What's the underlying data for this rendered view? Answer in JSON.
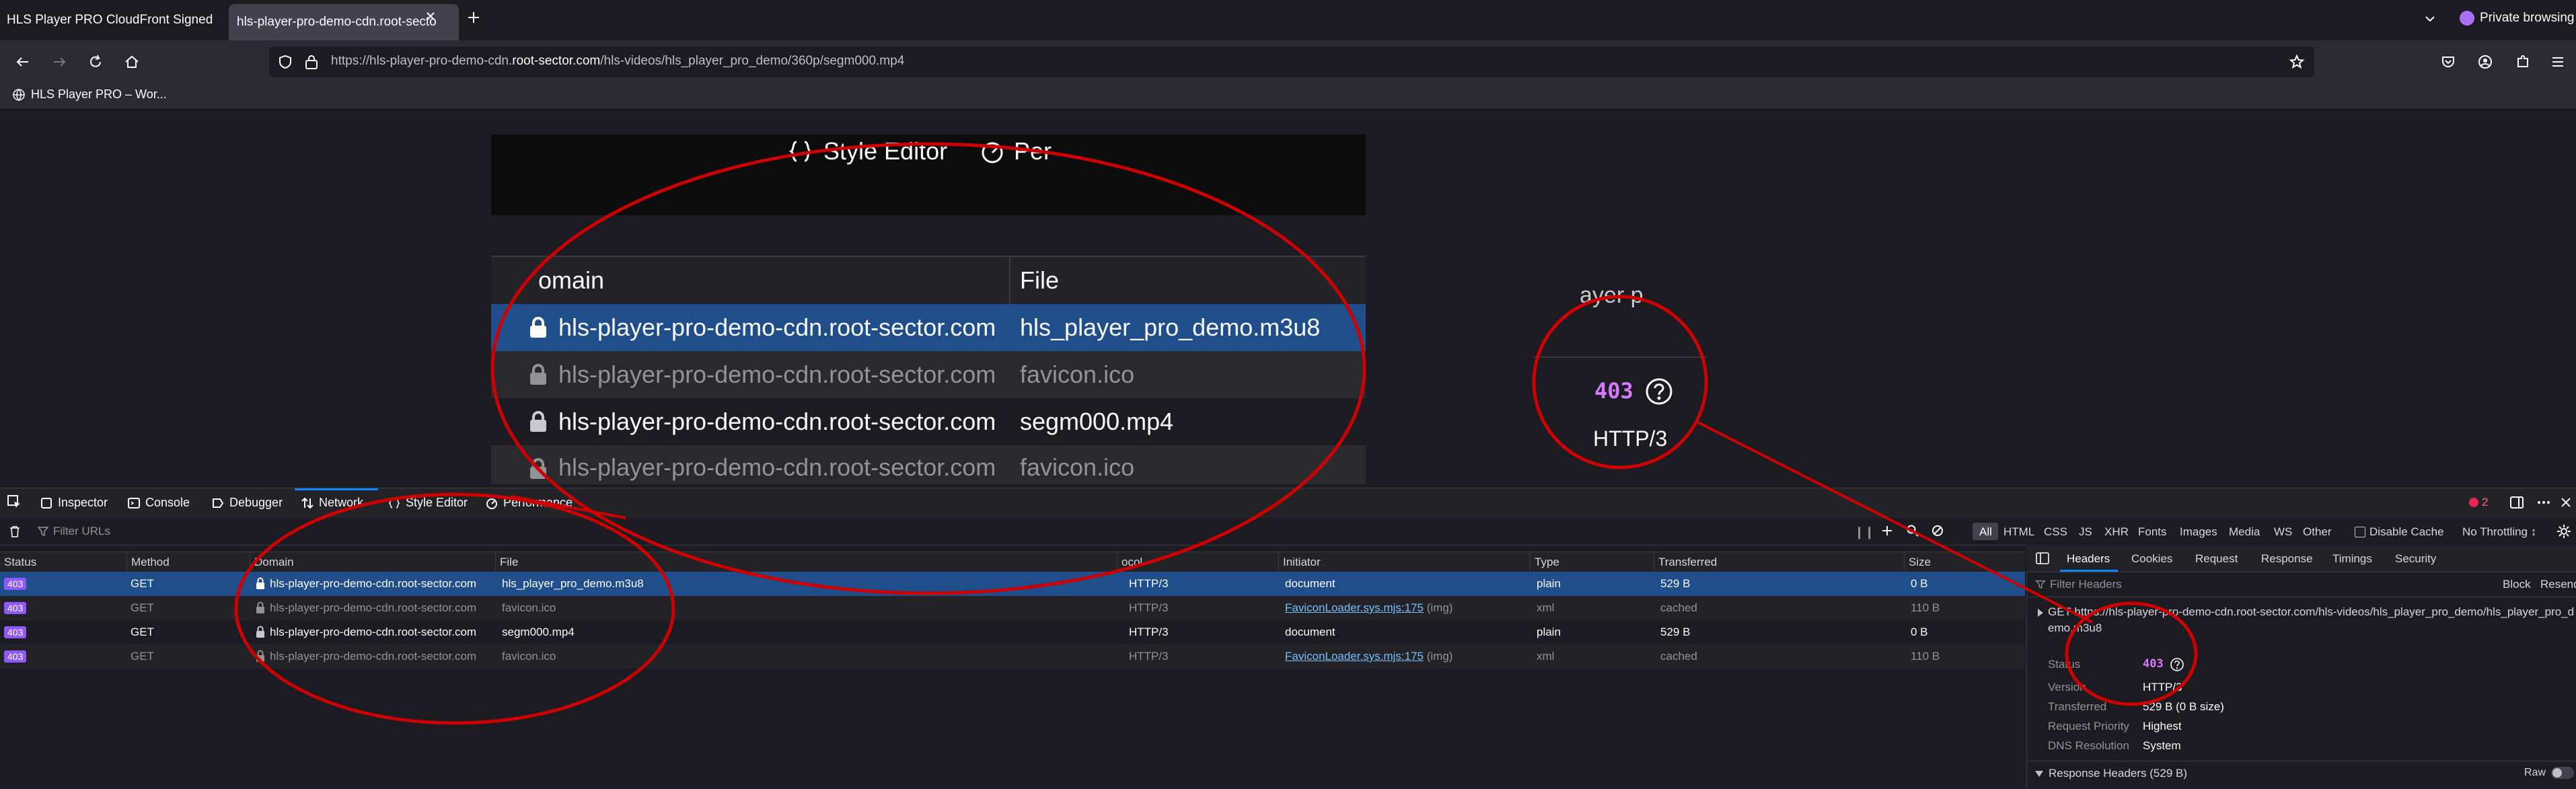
{
  "tabs": [
    {
      "label": "HLS Player PRO CloudFront Signed"
    },
    {
      "label": "hls-player-pro-demo-cdn.root-secto"
    }
  ],
  "private": {
    "label": "Private browsing"
  },
  "url": {
    "host_prefix": "https://hls-player-pro-demo-cdn.",
    "host_domain": "root-sector.com",
    "path": "/hls-videos/hls_player_pro_demo/360p/segm000.mp4"
  },
  "bookmark": {
    "label": "HLS Player PRO – Wor..."
  },
  "zoom_table": {
    "tabs": [
      "Style Editor",
      "Per"
    ],
    "headers": {
      "domain": "omain",
      "file": "File"
    },
    "rows": [
      {
        "domain": "hls-player-pro-demo-cdn.root-sector.com",
        "file": "hls_player_pro_demo.m3u8"
      },
      {
        "domain": "hls-player-pro-demo-cdn.root-sector.com",
        "file": "favicon.ico"
      },
      {
        "domain": "hls-player-pro-demo-cdn.root-sector.com",
        "file": "segm000.mp4"
      },
      {
        "domain": "hls-player-pro-demo-cdn.root-sector.com",
        "file": "favicon.ico"
      }
    ]
  },
  "zoom_status": {
    "top_text": "ayer p",
    "code": "403",
    "version": "HTTP/3"
  },
  "devtools": {
    "tools": [
      "Inspector",
      "Console",
      "Debugger",
      "Network",
      "Style Editor",
      "Performance"
    ],
    "error_count": "2",
    "filter_placeholder": "Filter URLs",
    "type_filters": [
      "All",
      "HTML",
      "CSS",
      "JS",
      "XHR",
      "Fonts",
      "Images",
      "Media",
      "WS",
      "Other"
    ],
    "disable_cache": "Disable Cache",
    "throttling": "No Throttling ↕",
    "columns": [
      "Status",
      "Method",
      "Domain",
      "File",
      "ocol",
      "Initiator",
      "Type",
      "Transferred",
      "Size"
    ],
    "requests": [
      {
        "status": "403",
        "method": "GET",
        "domain": "hls-player-pro-demo-cdn.root-sector.com",
        "file": "hls_player_pro_demo.m3u8",
        "protocol": "HTTP/3",
        "initiator": "document",
        "initiator_extra": "",
        "type": "plain",
        "transferred": "529 B",
        "size": "0 B"
      },
      {
        "status": "403",
        "method": "GET",
        "domain": "hls-player-pro-demo-cdn.root-sector.com",
        "file": "favicon.ico",
        "protocol": "HTTP/3",
        "initiator": "FaviconLoader.sys.mjs:175",
        "initiator_extra": "(img)",
        "type": "xml",
        "transferred": "cached",
        "size": "110 B"
      },
      {
        "status": "403",
        "method": "GET",
        "domain": "hls-player-pro-demo-cdn.root-sector.com",
        "file": "segm000.mp4",
        "protocol": "HTTP/3",
        "initiator": "document",
        "initiator_extra": "",
        "type": "plain",
        "transferred": "529 B",
        "size": "0 B"
      },
      {
        "status": "403",
        "method": "GET",
        "domain": "hls-player-pro-demo-cdn.root-sector.com",
        "file": "favicon.ico",
        "protocol": "HTTP/3",
        "initiator": "FaviconLoader.sys.mjs:175",
        "initiator_extra": "(img)",
        "type": "xml",
        "transferred": "cached",
        "size": "110 B"
      }
    ]
  },
  "side_panel": {
    "tabs": [
      "Headers",
      "Cookies",
      "Request",
      "Response",
      "Timings",
      "Security"
    ],
    "filter_placeholder": "Filter Headers",
    "block": "Block",
    "resend": "Resend",
    "get_line_1": "GET https://hls-player-pro-demo-cdn.root-sector.com/hls-videos/hls_player_pro_demo/hls_player_pro_d",
    "get_line_2": "emo.m3u8",
    "fields": [
      {
        "label": "Status",
        "value": "403"
      },
      {
        "label": "Version",
        "value": "HTTP/3"
      },
      {
        "label": "Transferred",
        "value": "529 B (0 B size)"
      },
      {
        "label": "Request Priority",
        "value": "Highest"
      },
      {
        "label": "DNS Resolution",
        "value": "System"
      }
    ],
    "response_headers": "Response Headers (529 B)",
    "raw": "Raw"
  },
  "colors": {
    "annotation": "#cc0000",
    "selected_row": "#204e8a",
    "badge": "#9059ff",
    "accent": "#0a84ff"
  }
}
